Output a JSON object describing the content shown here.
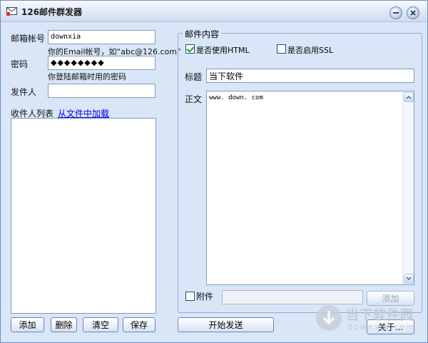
{
  "window": {
    "title": "126邮件群发器"
  },
  "account": {
    "email_label": "邮箱帐号",
    "email_value": "downxia",
    "email_hint": "你的Email帐号，如“abc@126.com”",
    "password_label": "密码",
    "password_value": "◆◆◆◆◆◆◆◆",
    "password_hint": "你登陆邮箱时用的密码",
    "sender_label": "发件人",
    "sender_value": ""
  },
  "recipients": {
    "label": "收件人列表",
    "load_link": "从文件中加载",
    "buttons": {
      "add": "添加",
      "delete": "删除",
      "clear": "清空",
      "save": "保存"
    }
  },
  "mail": {
    "group_title": "邮件内容",
    "use_html_label": "是否使用HTML",
    "use_html_checked": true,
    "use_ssl_label": "是否启用SSL",
    "use_ssl_checked": false,
    "subject_label": "标题",
    "subject_value": "当下软件",
    "body_label": "正文",
    "body_value": "www. down. com",
    "attachment_label": "附件",
    "attachment_checked": false,
    "attachment_value": "",
    "attachment_add_button": "添加"
  },
  "actions": {
    "send": "开始发送",
    "about": "关于..."
  },
  "watermark": {
    "brand": "当下软件园",
    "domain": "downxia.com"
  },
  "colors": {
    "window_bg": "#d9e6f7",
    "link": "#0000ee",
    "checkmark": "#21a121"
  }
}
